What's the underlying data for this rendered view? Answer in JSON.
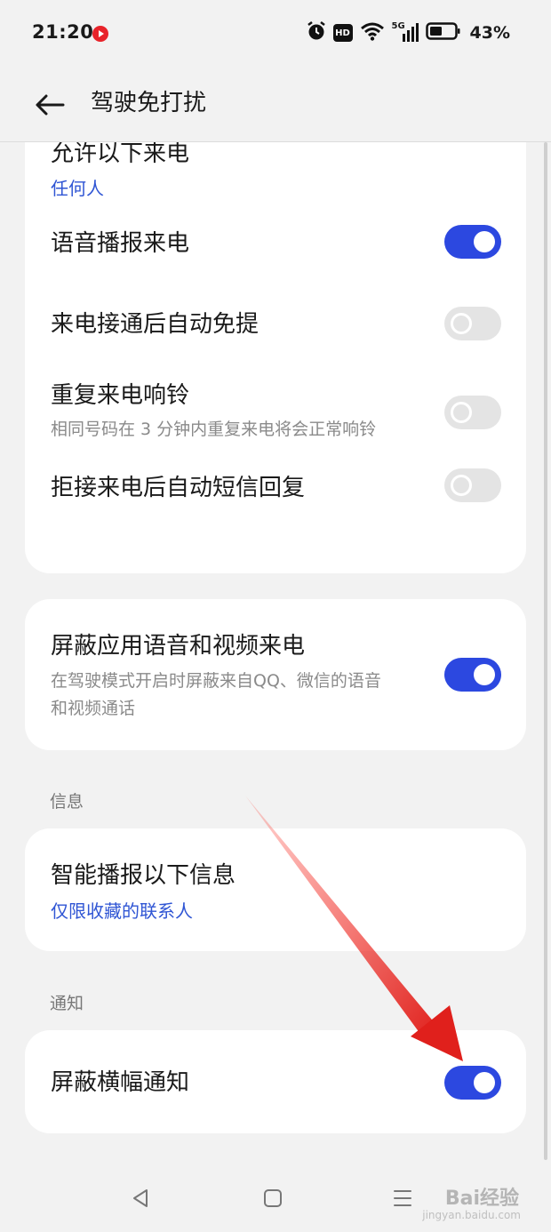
{
  "status_bar": {
    "time": "21:20",
    "battery_percent": "43%",
    "hd_label": "HD",
    "network_label": "5G",
    "icons": [
      "video-app-icon",
      "alarm-icon",
      "hd-icon",
      "wifi-icon",
      "signal-5g-icon",
      "battery-icon"
    ]
  },
  "header": {
    "title": "驾驶免打扰",
    "back_icon": "back-arrow-icon"
  },
  "calls_card": {
    "allow_calls": {
      "title": "允许以下来电",
      "value": "任何人"
    },
    "voice_announce": {
      "title": "语音播报来电",
      "toggle": true
    },
    "auto_handsfree": {
      "title": "来电接通后自动免提",
      "toggle": false
    },
    "repeat_ring": {
      "title": "重复来电响铃",
      "subtitle": "相同号码在 3 分钟内重复来电将会正常响铃",
      "toggle": false
    },
    "auto_sms_reply": {
      "title": "拒接来电后自动短信回复",
      "toggle": false
    }
  },
  "app_calls_card": {
    "title": "屏蔽应用语音和视频来电",
    "subtitle_line1": "在驾驶模式开启时屏蔽来自QQ、微信的语音",
    "subtitle_line2": "和视频通话",
    "toggle": true
  },
  "messages_section": {
    "label": "信息",
    "smart_announce": {
      "title": "智能播报以下信息",
      "value": "仅限收藏的联系人"
    }
  },
  "notifications_section": {
    "label": "通知",
    "block_banner": {
      "title": "屏蔽横幅通知",
      "toggle": true
    }
  },
  "nav_bar": {
    "icons": [
      "nav-back-icon",
      "nav-home-icon",
      "nav-recents-icon"
    ]
  },
  "watermark": {
    "text": "Bai经验",
    "subtext": "jingyan.baidu.com"
  },
  "colors": {
    "accent": "#2c48e0",
    "link": "#2f55d4",
    "toggle_off": "#e4e4e4",
    "background": "#f2f2f2",
    "card": "#ffffff",
    "annotation": "#e0201c"
  }
}
